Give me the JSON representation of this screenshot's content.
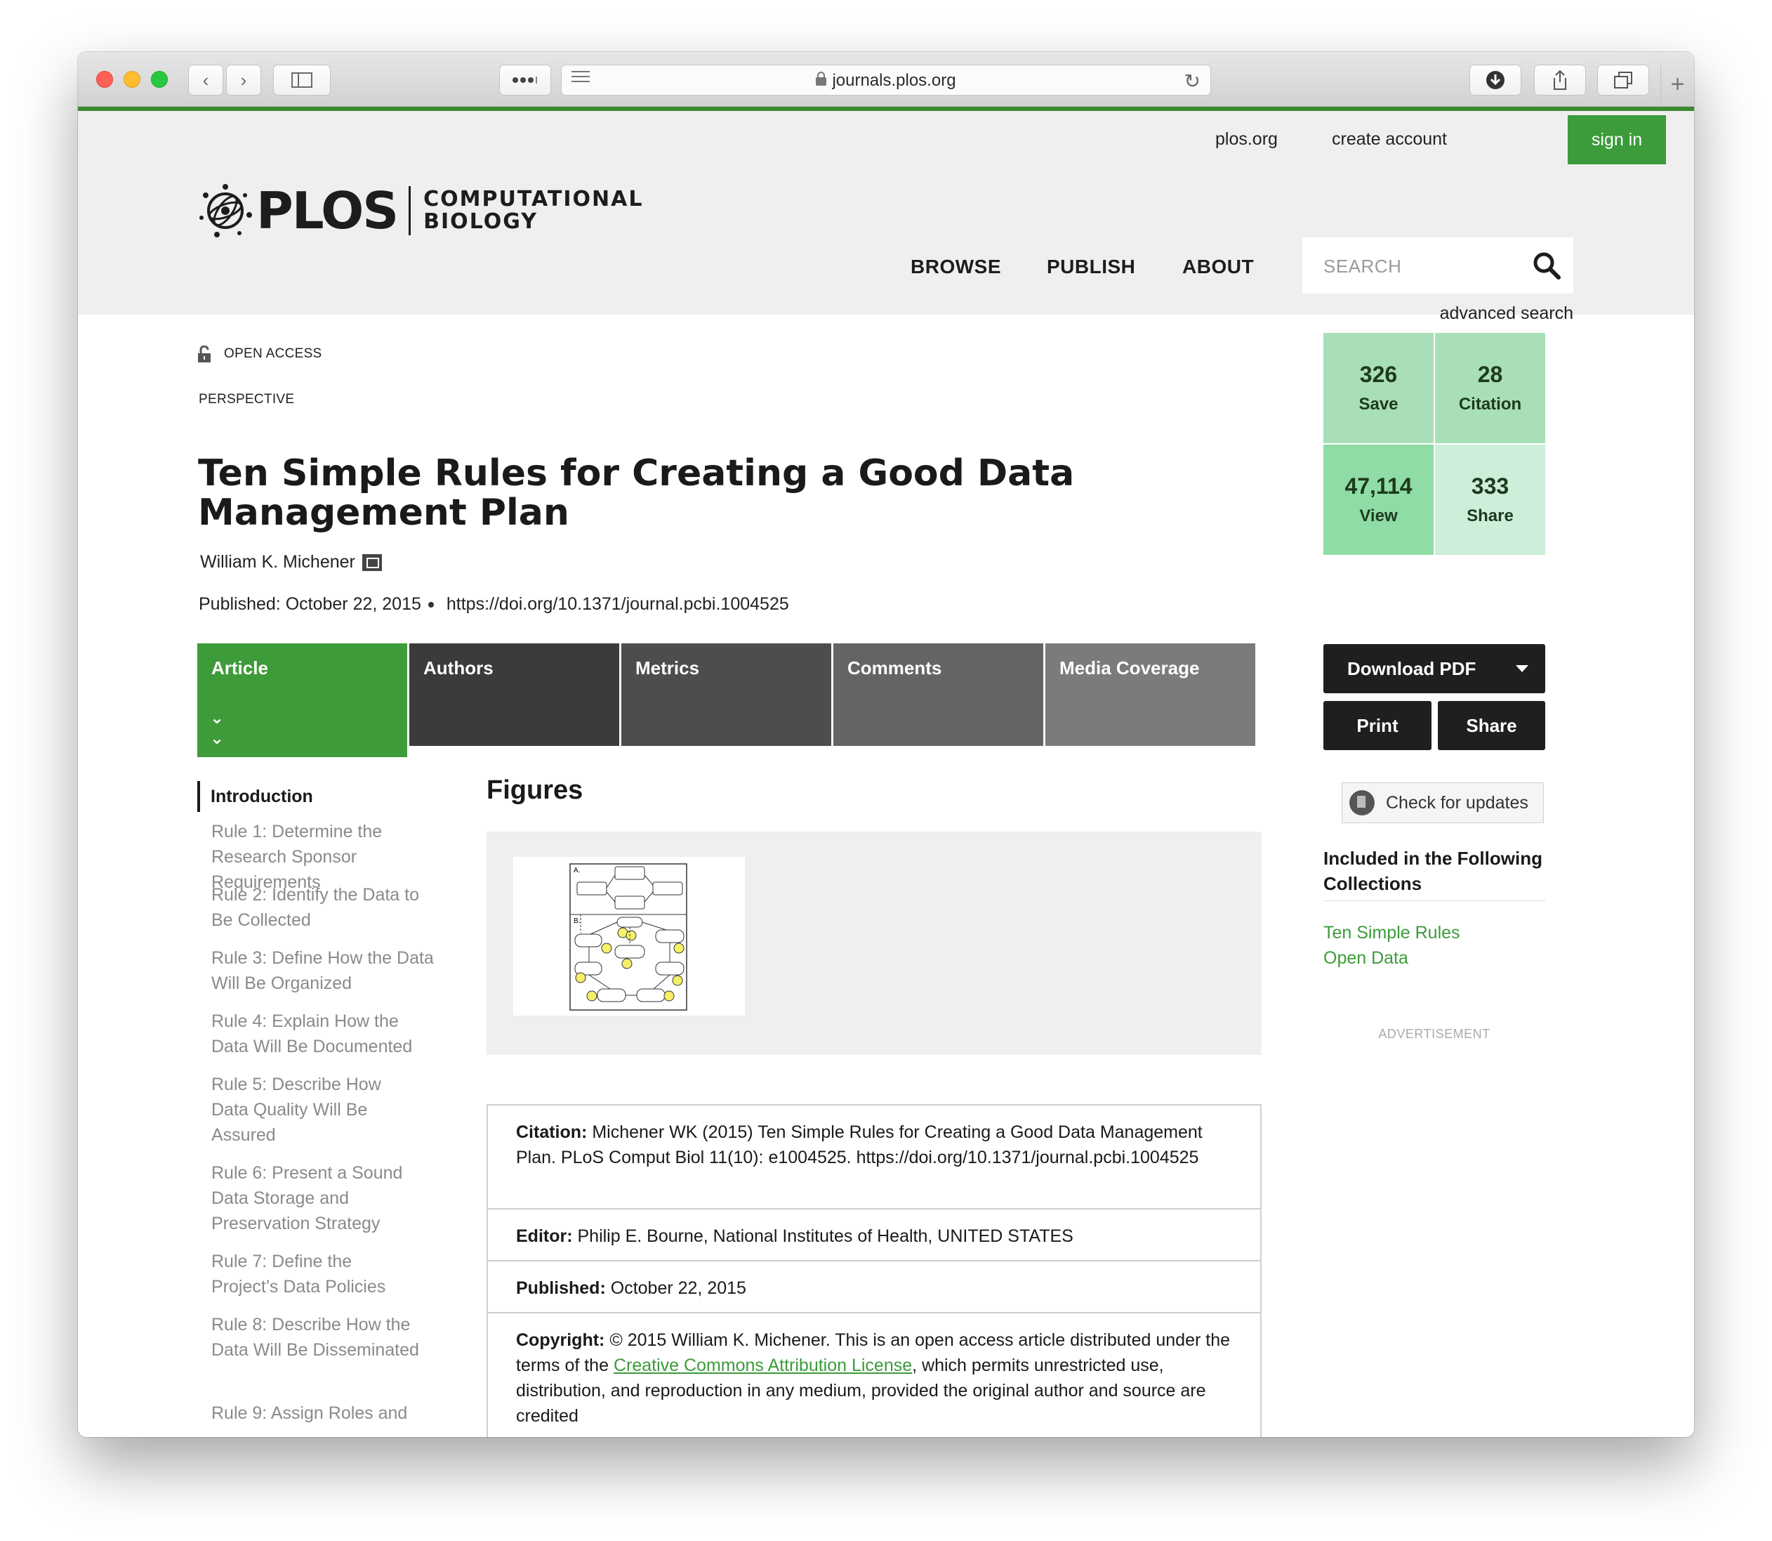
{
  "browser": {
    "url": "journals.plos.org",
    "traffic_lights": [
      "close",
      "minimize",
      "zoom"
    ]
  },
  "header": {
    "util_links": [
      "plos.org",
      "create account"
    ],
    "sign_in": "sign in",
    "logo": {
      "brand": "PLOS",
      "journal_line1": "COMPUTATIONAL",
      "journal_line2": "BIOLOGY"
    },
    "nav": [
      "BROWSE",
      "PUBLISH",
      "ABOUT"
    ],
    "search_placeholder": "SEARCH",
    "advanced_search": "advanced search"
  },
  "article": {
    "access": "OPEN ACCESS",
    "type": "PERSPECTIVE",
    "title": "Ten Simple Rules for Creating a Good Data Management Plan",
    "author": "William K. Michener",
    "published": "Published: October 22, 2015",
    "doi": "https://doi.org/10.1371/journal.pcbi.1004525"
  },
  "metrics": [
    {
      "value": "326",
      "label": "Save",
      "color": "#a8dfb8"
    },
    {
      "value": "28",
      "label": "Citation",
      "color": "#a8dfb8"
    },
    {
      "value": "47,114",
      "label": "View",
      "color": "#8fdca6"
    },
    {
      "value": "333",
      "label": "Share",
      "color": "#cdeed8"
    }
  ],
  "tabs": [
    {
      "label": "Article",
      "color": "#3e9b3a"
    },
    {
      "label": "Authors",
      "color": "#3b3b3b"
    },
    {
      "label": "Metrics",
      "color": "#4d4d4d"
    },
    {
      "label": "Comments",
      "color": "#646464"
    },
    {
      "label": "Media Coverage",
      "color": "#7b7b7b"
    }
  ],
  "actions": {
    "download_pdf": "Download PDF",
    "print": "Print",
    "share": "Share",
    "check_updates": "Check for updates"
  },
  "collections": {
    "title": "Included in the Following Collections",
    "items": [
      "Ten Simple Rules",
      "Open Data"
    ]
  },
  "advertisement": "ADVERTISEMENT",
  "toc": {
    "active": "Introduction",
    "items": [
      "Rule 1: Determine the Research Sponsor Requirements",
      "Rule 2: Identify the Data to Be Collected",
      "Rule 3: Define How the Data Will Be Organized",
      "Rule 4: Explain How the Data Will Be Documented",
      "Rule 5: Describe How Data Quality Will Be Assured",
      "Rule 6: Present a Sound Data Storage and Preservation Strategy",
      "Rule 7: Define the Project’s Data Policies",
      "Rule 8: Describe How the Data Will Be Disseminated",
      "Rule 9: Assign Roles and"
    ]
  },
  "figures": {
    "heading": "Figures",
    "thumb_labels": [
      "A.",
      "B."
    ]
  },
  "citation": {
    "citation_label": "Citation:",
    "citation_text": "Michener WK (2015) Ten Simple Rules for Creating a Good Data Management Plan. PLoS Comput Biol 11(10): e1004525. https://doi.org/10.1371/journal.pcbi.1004525",
    "editor_label": "Editor:",
    "editor_text": "Philip E. Bourne, National Institutes of Health, UNITED STATES",
    "published_label": "Published:",
    "published_text": "October 22, 2015",
    "copyright_label": "Copyright:",
    "copyright_pre": "© 2015 William K. Michener. This is an open access article distributed under the terms of the",
    "license_link": "Creative Commons Attribution License",
    "copyright_post": ", which permits unrestricted use, distribution, and reproduction in any medium, provided the original author and source are credited"
  },
  "colors": {
    "accent": "#3c9b3a",
    "header_bg": "#efefef",
    "dark_button": "#1f1f1f"
  }
}
